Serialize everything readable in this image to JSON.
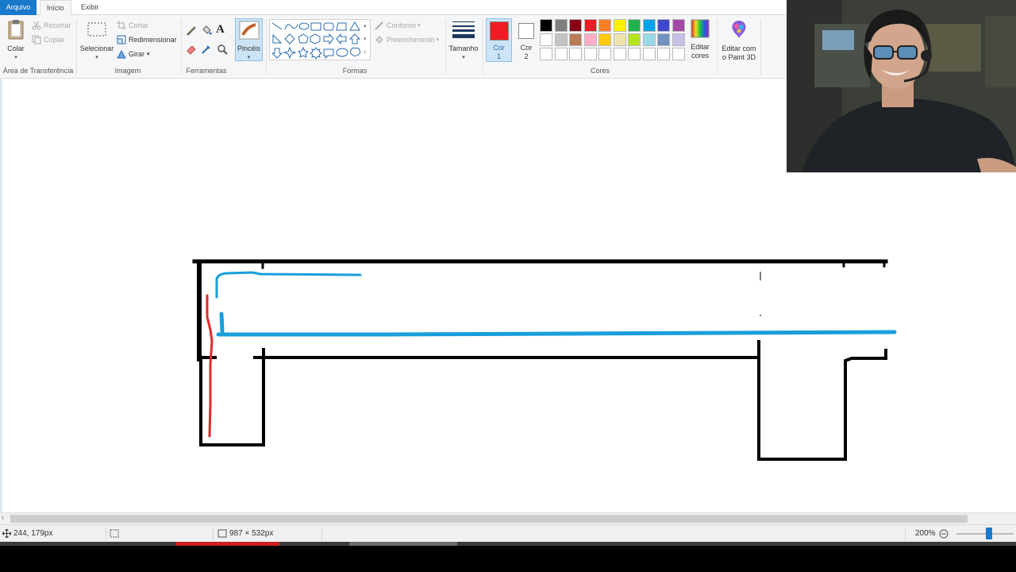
{
  "ribbon": {
    "tabs": [
      {
        "label": "Arquivo"
      },
      {
        "label": "Início"
      },
      {
        "label": "Exibir"
      }
    ],
    "clipboard": {
      "paste": "Colar",
      "cut": "Recortar",
      "copy": "Copiar",
      "group_label": "Área de Transferência"
    },
    "image": {
      "select": "Selecionar",
      "crop": "Cortar",
      "resize": "Redimensionar",
      "rotate": "Girar",
      "group_label": "Imagem"
    },
    "tools": {
      "group_label": "Ferramentas",
      "text_glyph": "A"
    },
    "brushes": {
      "label": "Pincéis"
    },
    "shapes": {
      "outline": "Contorno",
      "fill": "Preenchimento",
      "group_label": "Formas"
    },
    "size": {
      "label": "Tamanho"
    },
    "colors": {
      "color1_label": "Cor\n1",
      "color2_label": "Cor\n2",
      "color1_value": "#ed1c24",
      "color2_value": "#ffffff",
      "edit_colors": "Editar\ncores",
      "group_label": "Cores",
      "palette_row1": [
        "#000000",
        "#7f7f7f",
        "#880015",
        "#ed1c24",
        "#ff7f27",
        "#fff200",
        "#22b14c",
        "#00a2e8",
        "#3f48cc",
        "#a349a4"
      ],
      "palette_row2": [
        "#ffffff",
        "#c3c3c3",
        "#b97a57",
        "#ffaec9",
        "#ffc90e",
        "#efe4b0",
        "#b5e61d",
        "#99d9ea",
        "#7092be",
        "#c8bfe7"
      ]
    },
    "paint3d": {
      "label": "Editar com\no Paint 3D"
    }
  },
  "canvas": {
    "line_colors": {
      "outline": "#000000",
      "blue": "#1a9edb",
      "red": "#e02a2a"
    }
  },
  "status": {
    "cursor_pos": "244, 179px",
    "selection_size": "",
    "image_size": "987 × 532px",
    "zoom": "200%"
  }
}
